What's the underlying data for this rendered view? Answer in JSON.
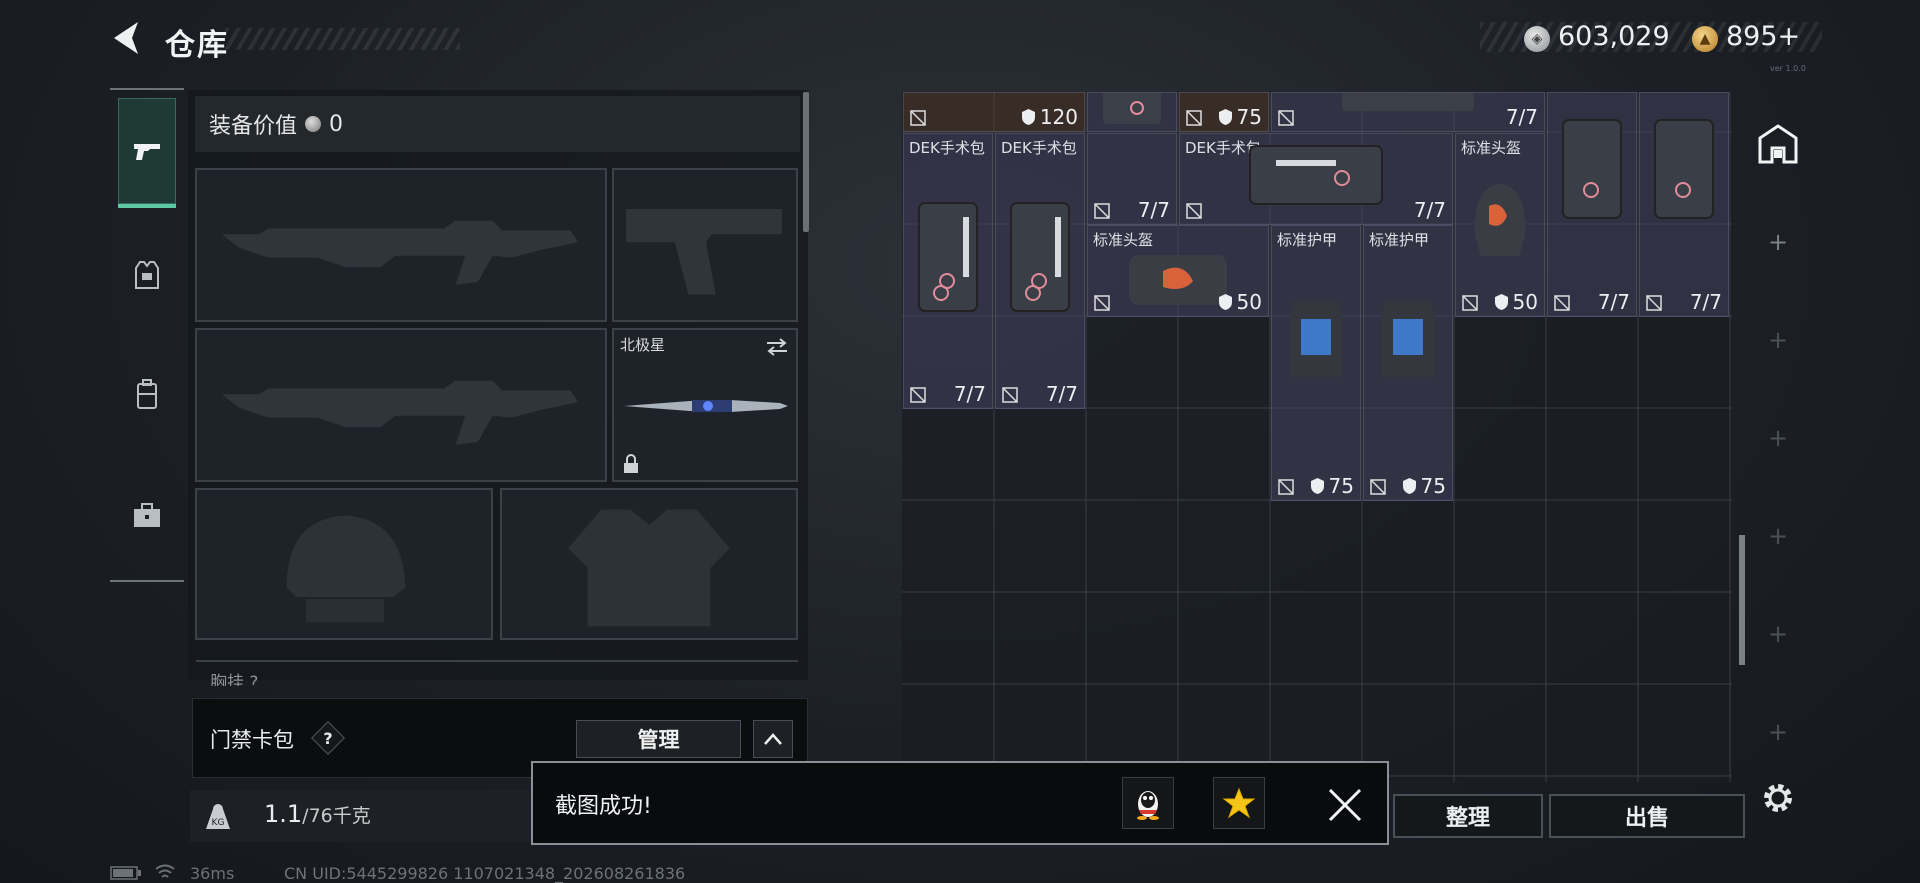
{
  "header": {
    "title": "仓库"
  },
  "currency": {
    "silver": "603,029",
    "gold": "895+"
  },
  "version_tag": "ver 1.0.0",
  "equipment": {
    "value_label": "装备价值",
    "value": "0",
    "melee_slot_label": "北极星",
    "chest_label": "胸挂 ?"
  },
  "keycard": {
    "label": "门禁卡包",
    "help": "?",
    "manage_label": "管理"
  },
  "weight": {
    "value": "1.1",
    "capacity": "/76千克"
  },
  "status": {
    "ping": "36ms",
    "uid": "CN UID:5445299826 1107021348_202608261836"
  },
  "inventory": {
    "items": [
      {
        "name": "",
        "stat": "120",
        "stat_type": "durability"
      },
      {
        "name": "",
        "stat": "75",
        "stat_type": "durability"
      },
      {
        "name": "",
        "stat": "7/7",
        "stat_type": "uses"
      },
      {
        "name": "DEK手术包",
        "stat": "7/7",
        "stat_type": "uses"
      },
      {
        "name": "DEK手术包",
        "stat": "7/7",
        "stat_type": "uses"
      },
      {
        "name": "",
        "stat": "7/7",
        "stat_type": "uses"
      },
      {
        "name": "DEK手术包",
        "stat": "7/7",
        "stat_type": "uses"
      },
      {
        "name": "标准头盔",
        "stat": "50",
        "stat_type": "durability"
      },
      {
        "name": "",
        "stat": "7/7",
        "stat_type": "uses"
      },
      {
        "name": "",
        "stat": "7/7",
        "stat_type": "uses"
      },
      {
        "name": "标准头盔",
        "stat": "50",
        "stat_type": "durability"
      },
      {
        "name": "标准护甲",
        "stat": "75",
        "stat_type": "durability"
      },
      {
        "name": "标准护甲",
        "stat": "75",
        "stat_type": "durability"
      }
    ]
  },
  "buttons": {
    "sort": "整理",
    "sell": "出售"
  },
  "toast": {
    "message": "截图成功!"
  },
  "colors": {
    "accent": "#5cc9a4",
    "item_bg": "#464260",
    "panel": "#1a1e22"
  }
}
